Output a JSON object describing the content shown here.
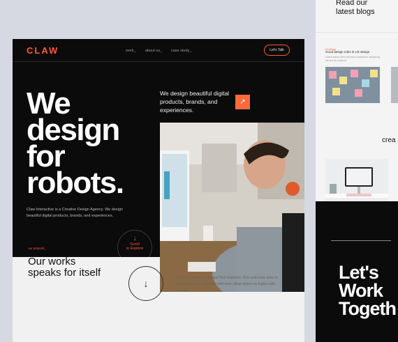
{
  "nav": {
    "logo": "CLAW",
    "links": [
      "work_",
      "about us_",
      "case study_"
    ],
    "cta": "Let's Talk"
  },
  "hero": {
    "title_lines": [
      "We",
      "design",
      "for",
      "robots."
    ],
    "description": "Claw Interactive is a Creative Design Agency. We design beautiful digital products, brands, and experiences.",
    "tagline": "We design beautiful digital products, brands, and experiences.",
    "arrow_icon": "arrow-up-right-icon",
    "scroll_label_1": "Scroll",
    "scroll_label_2": "to Explore"
  },
  "works": {
    "label": "our projects_",
    "title_line1": "Our works",
    "title_line2": "speaks for itself",
    "description": "We help people to reshape their business. Duis aute irure dolor in reprehenderit in voluptate velit esse cillum dolore eu fugiat nulla pariatur."
  },
  "blog": {
    "title_line1": "Read our",
    "title_line2": "latest blogs",
    "category": "UI design",
    "headline": "Good design rules in UX design",
    "summary": "Lorem ipsum dolor sit amet consectetur adipiscing elit sed do eiusmod."
  },
  "side": {
    "crea": "crea",
    "lets_work_1": "Let's",
    "lets_work_2": "Work",
    "lets_work_3": "Togeth"
  },
  "colors": {
    "accent": "#ff5a36",
    "dark": "#0b0b0b",
    "light": "#f1f1f1"
  }
}
